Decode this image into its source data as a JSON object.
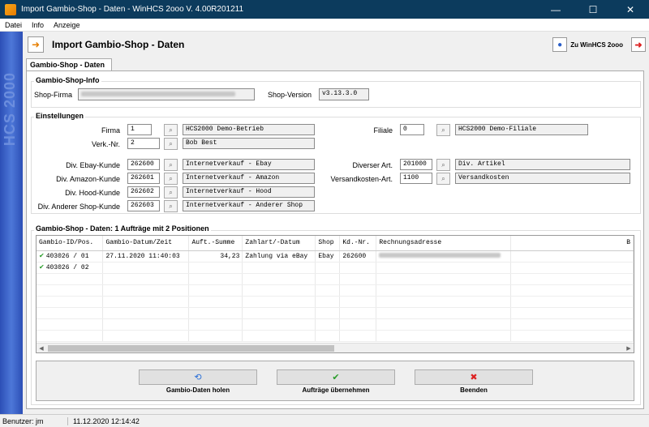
{
  "window": {
    "title": "Import Gambio-Shop - Daten - WinHCS 2ooo V. 4.00R201211",
    "minimize": "—",
    "maximize": "☐",
    "close": "✕"
  },
  "menu": [
    "Datei",
    "Info",
    "Anzeige"
  ],
  "sidebar_text": "HCS 2000",
  "header": {
    "title": "Import Gambio-Shop - Daten",
    "goto_label": "Zu WinHCS 2ooo"
  },
  "tab": "Gambio-Shop - Daten",
  "shop_info": {
    "title": "Gambio-Shop-Info",
    "firma_label": "Shop-Firma",
    "version_label": "Shop-Version",
    "version_value": "v3.13.3.0"
  },
  "settings": {
    "title": "Einstellungen",
    "firma_label": "Firma",
    "firma_value": "1",
    "firma_name": "HCS2000 Demo-Betrieb",
    "verk_label": "Verk.-Nr.",
    "verk_value": "2",
    "verk_name": "Bob Best",
    "filiale_label": "Filiale",
    "filiale_value": "0",
    "filiale_name": "HCS2000 Demo-Filiale",
    "ebay_label": "Div. Ebay-Kunde",
    "ebay_value": "262600",
    "ebay_name": "Internetverkauf - Ebay",
    "amazon_label": "Div. Amazon-Kunde",
    "amazon_value": "262601",
    "amazon_name": "Internetverkauf - Amazon",
    "hood_label": "Div. Hood-Kunde",
    "hood_value": "262602",
    "hood_name": "Internetverkauf - Hood",
    "other_label": "Div. Anderer Shop-Kunde",
    "other_value": "262603",
    "other_name": "Internetverkauf - Anderer Shop",
    "diverser_label": "Diverser Art.",
    "diverser_value": "201000",
    "diverser_name": "Div. Artikel",
    "versand_label": "Versandkosten-Art.",
    "versand_value": "1100",
    "versand_name": "Versandkosten"
  },
  "orders": {
    "title": "Gambio-Shop - Daten: 1 Aufträge mit 2 Positionen",
    "columns": [
      "Gambio-ID/Pos.",
      "Gambio-Datum/Zeit",
      "Auft.-Summe",
      "Zahlart/-Datum",
      "Shop",
      "Kd.-Nr.",
      "Rechnungsadresse",
      "B"
    ],
    "rows": [
      {
        "id": "403026 / 01",
        "datum": "27.11.2020 11:40:03",
        "summe": "34,23",
        "zahlart": "Zahlung via eBay",
        "shop": "Ebay",
        "kdnr": "262600"
      },
      {
        "id": "403026 / 02",
        "datum": "",
        "summe": "",
        "zahlart": "",
        "shop": "",
        "kdnr": ""
      }
    ]
  },
  "actions": {
    "fetch": "Gambio-Daten holen",
    "accept": "Aufträge übernehmen",
    "quit": "Beenden"
  },
  "status": {
    "user": "Benutzer: jm",
    "datetime": "11.12.2020 12:14:42"
  }
}
